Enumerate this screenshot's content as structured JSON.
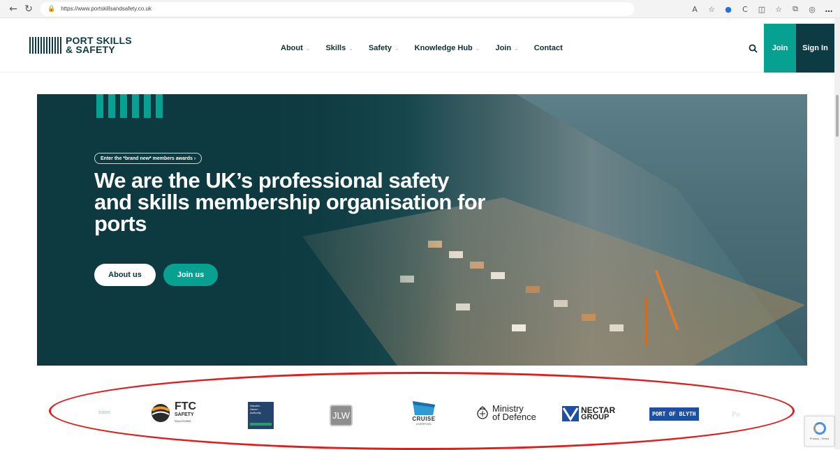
{
  "browser": {
    "url": "https://www.portskillsandsafety.co.uk",
    "back_icon": "arrow-left-icon",
    "refresh_icon": "refresh-icon"
  },
  "header": {
    "logo_line1": "PORT SKILLS",
    "logo_line2": "& SAFETY",
    "nav": [
      {
        "label": "About",
        "has_dropdown": true
      },
      {
        "label": "Skills",
        "has_dropdown": true
      },
      {
        "label": "Safety",
        "has_dropdown": true
      },
      {
        "label": "Knowledge Hub",
        "has_dropdown": true
      },
      {
        "label": "Join",
        "has_dropdown": true
      },
      {
        "label": "Contact",
        "has_dropdown": false
      }
    ],
    "search_icon": "search-icon",
    "join_label": "Join",
    "signin_label": "Sign In"
  },
  "hero": {
    "awards_pill": "Enter the *brand new* members awards  ›",
    "title_line1": "We are the UK’s professional safety",
    "title_line2": "and skills membership organisation for",
    "title_line3": "ports",
    "about_button": "About us",
    "join_button": "Join us"
  },
  "partners": {
    "items": [
      {
        "name": "FTC",
        "sub": "SAFETY",
        "sub2": "SOLUTIONS"
      },
      {
        "name": "Harwich",
        "sub": "Haven",
        "sub2": "Authority"
      },
      {
        "name": "JLW"
      },
      {
        "name": "CRUISE",
        "sub": "LIVERPOOL"
      },
      {
        "name": "Ministry",
        "sub": "of Defence"
      },
      {
        "name": "NECTAR",
        "sub": "GROUP"
      },
      {
        "name": "PORT OF BLYTH"
      }
    ],
    "left_fragment": "ssion",
    "right_fragment": "Po"
  },
  "recaptcha": {
    "text": "Privacy - Terms"
  },
  "colors": {
    "brand_dark": "#0d3b44",
    "brand_teal": "#07a192",
    "highlight_red": "#e31b1b"
  }
}
